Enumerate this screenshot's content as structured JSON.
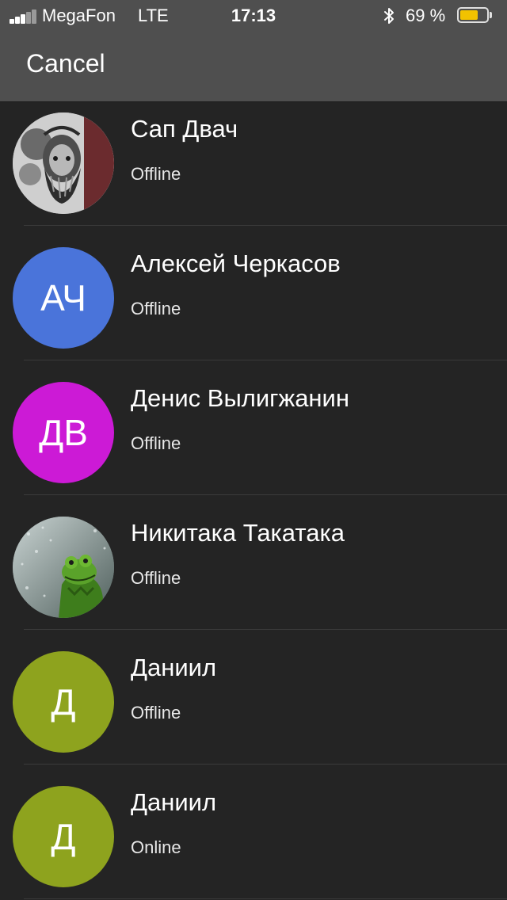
{
  "status_bar": {
    "carrier": "MegaFon",
    "network": "LTE",
    "time": "17:13",
    "battery_text": "69 %",
    "battery_level": 0.69,
    "signal_bars_filled": 3,
    "signal_bars_total": 5,
    "battery_color": "#f2c200"
  },
  "header": {
    "cancel_label": "Cancel"
  },
  "contacts": [
    {
      "name": "Сап Двач",
      "status": "Offline",
      "avatar": "photo-bearded-man"
    },
    {
      "name": "Алексей Черкасов",
      "status": "Offline",
      "initials": "АЧ",
      "color": "#4a74da"
    },
    {
      "name": "Денис Вылигжанин",
      "status": "Offline",
      "initials": "ДВ",
      "color": "#cc1ad6"
    },
    {
      "name": "Никитака Такатака",
      "status": "Offline",
      "avatar": "photo-kermit"
    },
    {
      "name": "Даниил",
      "status": "Offline",
      "initials": "Д",
      "color": "#8ea31e"
    },
    {
      "name": "Даниил",
      "status": "Online",
      "initials": "Д",
      "color": "#8ea31e"
    }
  ]
}
